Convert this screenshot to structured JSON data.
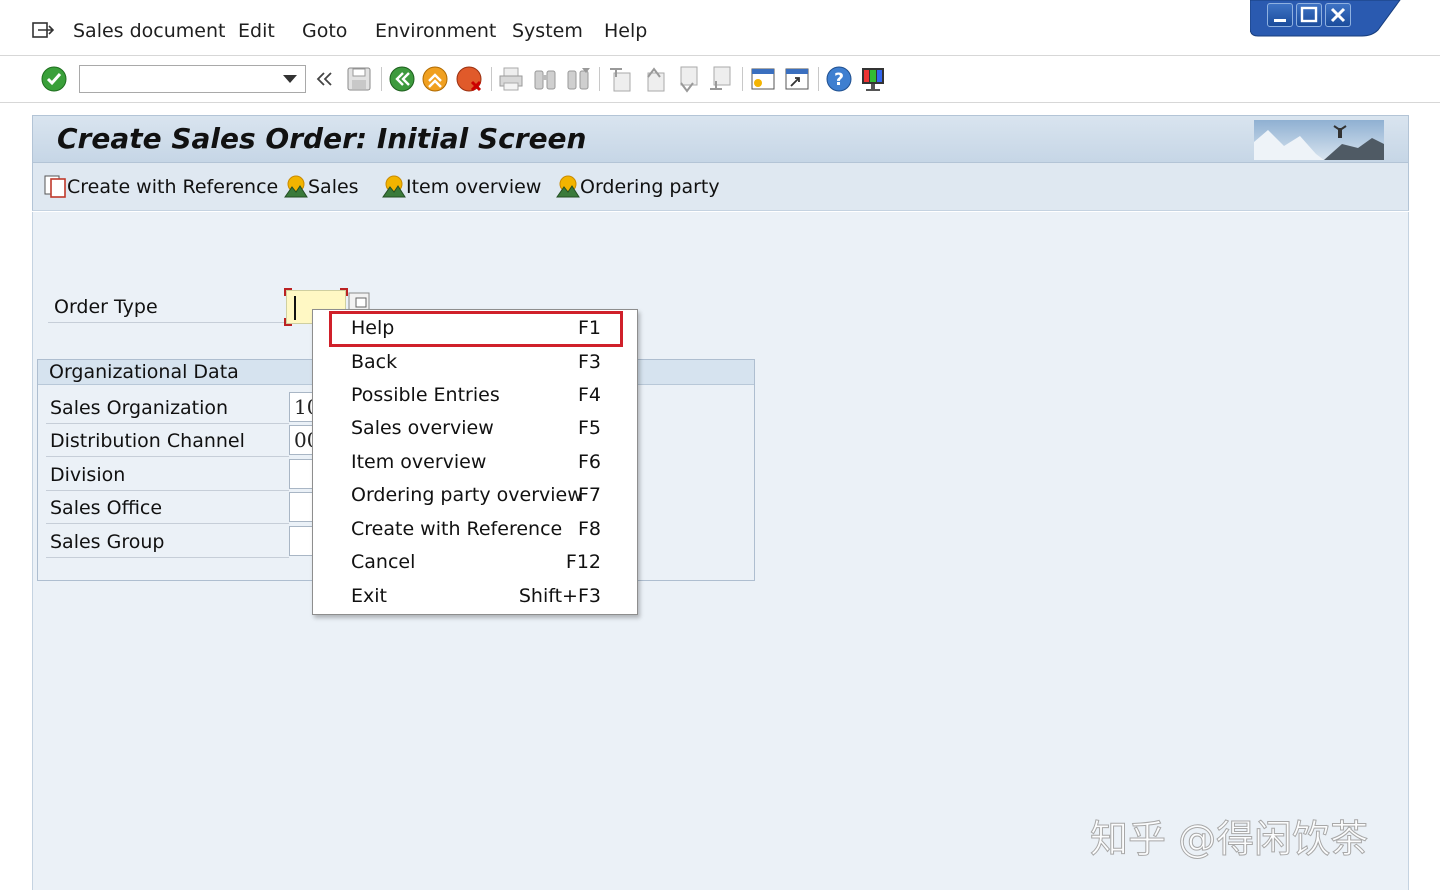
{
  "menubar": {
    "items": [
      "Sales document",
      "Edit",
      "Goto",
      "Environment",
      "System",
      "Help"
    ]
  },
  "toolbar": {
    "command_field_value": "",
    "icons": [
      "enter-icon",
      "back-nav-icon",
      "save-icon",
      "back-icon",
      "exit-icon",
      "cancel-icon",
      "print-icon",
      "find-icon",
      "find-next-icon",
      "first-page-icon",
      "previous-page-icon",
      "next-page-icon",
      "last-page-icon",
      "new-session-icon",
      "shortcut-icon",
      "help-icon",
      "customize-layout-icon"
    ]
  },
  "title": {
    "text": "Create Sales Order: Initial Screen"
  },
  "app_toolbar": {
    "buttons": [
      "Create with Reference",
      "Sales",
      "Item overview",
      "Ordering party"
    ]
  },
  "form": {
    "order_type_label": "Order Type",
    "order_type_value": "",
    "org_data_title": "Organizational Data",
    "fields": [
      {
        "label": "Sales Organization",
        "value": "10"
      },
      {
        "label": "Distribution Channel",
        "value": "00"
      },
      {
        "label": "Division",
        "value": ""
      },
      {
        "label": "Sales Office",
        "value": ""
      },
      {
        "label": "Sales Group",
        "value": ""
      }
    ]
  },
  "context_menu": {
    "items": [
      {
        "label": "Help",
        "key": "F1",
        "highlighted": true
      },
      {
        "label": "Back",
        "key": "F3"
      },
      {
        "label": "Possible Entries",
        "key": "F4"
      },
      {
        "label": "Sales overview",
        "key": "F5"
      },
      {
        "label": "Item overview",
        "key": "F6"
      },
      {
        "label": "Ordering party overview",
        "key": "F7"
      },
      {
        "label": "Create with Reference",
        "key": "F8"
      },
      {
        "label": "Cancel",
        "key": "F12"
      },
      {
        "label": "Exit",
        "key": "Shift+F3"
      }
    ],
    "highlight_color": "#d0202a"
  },
  "watermark": {
    "text": "知乎 @得闲饮茶"
  }
}
